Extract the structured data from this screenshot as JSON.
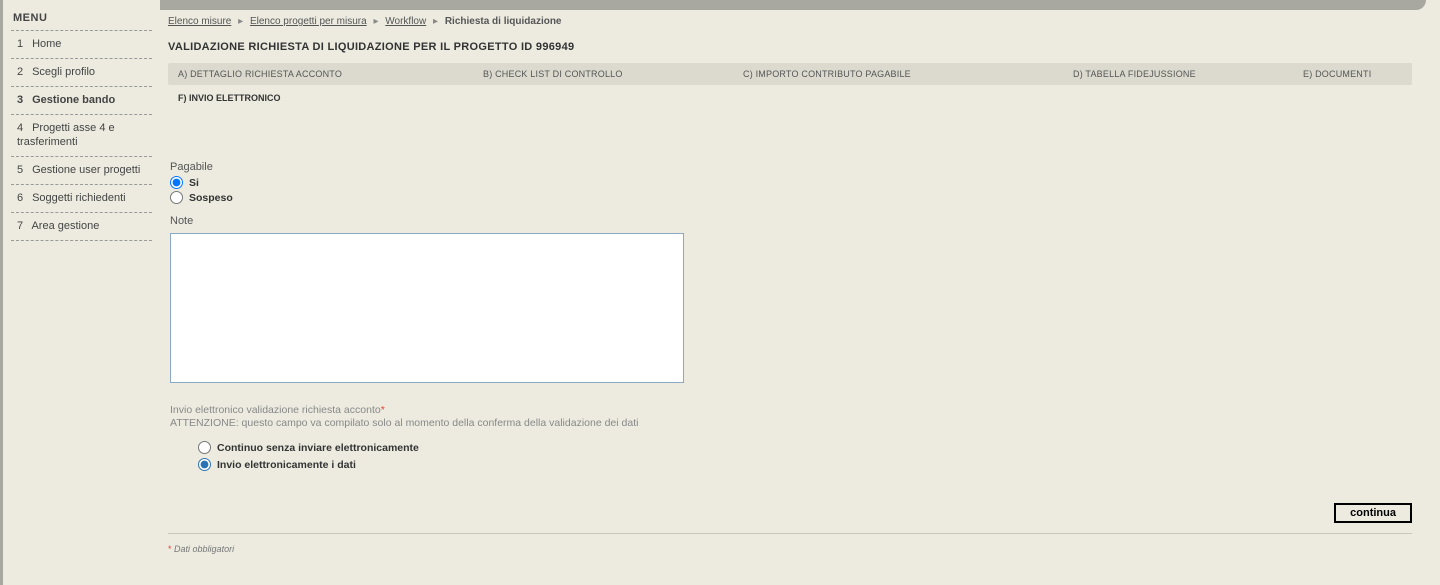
{
  "menu": {
    "title": "MENU",
    "items": [
      {
        "index": "1",
        "label": "Home"
      },
      {
        "index": "2",
        "label": "Scegli profilo"
      },
      {
        "index": "3",
        "label": "Gestione bando"
      },
      {
        "index": "4",
        "label": "Progetti asse 4 e trasferimenti"
      },
      {
        "index": "5",
        "label": "Gestione user progetti"
      },
      {
        "index": "6",
        "label": "Soggetti richiedenti"
      },
      {
        "index": "7",
        "label": "Area gestione"
      }
    ],
    "active_index": 2
  },
  "breadcrumb": {
    "items": [
      "Elenco misure",
      "Elenco progetti per misura",
      "Workflow"
    ],
    "current": "Richiesta di liquidazione"
  },
  "page_title": "VALIDAZIONE RICHIESTA DI LIQUIDAZIONE PER IL PROGETTO ID 996949",
  "tabs_row1": [
    "A) DETTAGLIO RICHIESTA ACCONTO",
    "B) CHECK LIST DI CONTROLLO",
    "C) IMPORTO CONTRIBUTO PAGABILE",
    "D) TABELLA FIDEJUSSIONE",
    "E) DOCUMENTI"
  ],
  "tabs_row2_label": "F) INVIO ELETTRONICO",
  "form": {
    "pagabile_label": "Pagabile",
    "opt_si": "Si",
    "opt_sospeso": "Sospeso",
    "note_label": "Note",
    "note_value": "",
    "hint_title": "Invio elettronico validazione richiesta acconto",
    "hint_body": "ATTENZIONE: questo campo va compilato solo al momento della conferma della validazione dei dati",
    "send_opt1": "Continuo senza inviare elettronicamente",
    "send_opt2": "Invio elettronicamente i dati"
  },
  "buttons": {
    "continua": "continua"
  },
  "footer": {
    "mandatory": "Dati obbligatori"
  }
}
